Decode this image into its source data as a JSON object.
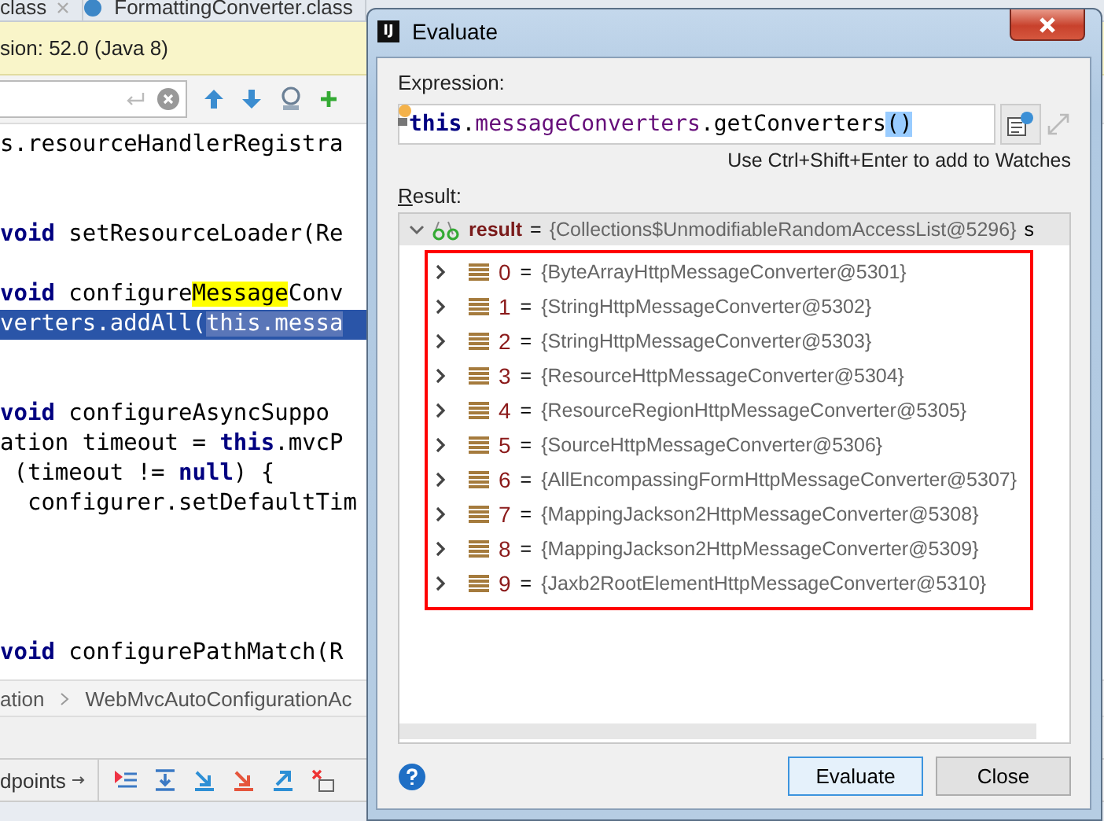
{
  "editor_tabs": [
    {
      "label": "class",
      "selected": false
    },
    {
      "label": "FormattingConverter.class",
      "selected": false
    }
  ],
  "banner": "sion: 52.0 (Java 8)",
  "code_lines": [
    {
      "selected": false,
      "tokens": [
        {
          "kind": "plain",
          "text": "s.resourceHandlerRegistra"
        }
      ]
    },
    {
      "selected": false
    },
    {
      "selected": false
    },
    {
      "selected": false,
      "tokens": [
        {
          "kind": "keyword",
          "text": "void"
        },
        {
          "kind": "plain",
          "text": " setResourceLoader(Re"
        }
      ]
    },
    {
      "selected": false
    },
    {
      "selected": false,
      "tokens": [
        {
          "kind": "keyword",
          "text": "void"
        },
        {
          "kind": "plain",
          "text": " configure"
        },
        {
          "kind": "match",
          "text": "Message"
        },
        {
          "kind": "plain",
          "text": "Conv"
        }
      ]
    },
    {
      "selected": true,
      "tokens": [
        {
          "kind": "plain",
          "text": "verters.addAll("
        },
        {
          "kind": "occurrence",
          "text": "this."
        },
        {
          "kind": "occurrence",
          "text": "messa"
        }
      ]
    },
    {
      "selected": false
    },
    {
      "selected": false
    },
    {
      "selected": false,
      "tokens": [
        {
          "kind": "keyword",
          "text": "void"
        },
        {
          "kind": "plain",
          "text": " configureAsyncSuppo"
        }
      ]
    },
    {
      "selected": false,
      "tokens": [
        {
          "kind": "plain",
          "text": "ation timeout = "
        },
        {
          "kind": "keyword",
          "text": "this"
        },
        {
          "kind": "plain",
          "text": ".mvcP"
        }
      ]
    },
    {
      "selected": false,
      "tokens": [
        {
          "kind": "plain",
          "text": " (timeout != "
        },
        {
          "kind": "keyword",
          "text": "null"
        },
        {
          "kind": "plain",
          "text": ") {"
        }
      ]
    },
    {
      "selected": false,
      "tokens": [
        {
          "kind": "plain",
          "text": "  configurer.setDefaultTim"
        }
      ]
    },
    {
      "selected": false
    },
    {
      "selected": false
    },
    {
      "selected": false
    },
    {
      "selected": false
    },
    {
      "selected": false,
      "tokens": [
        {
          "kind": "keyword",
          "text": "void"
        },
        {
          "kind": "plain",
          "text": " configurePathMatch(R"
        }
      ]
    }
  ],
  "breadcrumb": [
    "ation",
    "WebMvcAutoConfigurationAc"
  ],
  "debug_toolbar": {
    "label": "dpoints"
  },
  "dialog": {
    "logo": "IJ",
    "title": "Evaluate",
    "expression_label": "Expression:",
    "expression": [
      {
        "kind": "keyword",
        "text": "this"
      },
      {
        "kind": "plain",
        "text": "."
      },
      {
        "kind": "field",
        "text": "messageConverters"
      },
      {
        "kind": "plain",
        "text": ".getConverters"
      },
      {
        "kind": "brace",
        "text": "()"
      }
    ],
    "hint": "Use Ctrl+Shift+Enter to add to Watches",
    "result_label": "Result:",
    "result": {
      "name": "result",
      "op": "=",
      "value": "{Collections$UnmodifiableRandomAccessList@5296}",
      "extra": "s",
      "expanded": true,
      "children": [
        {
          "name": "0",
          "op": "=",
          "value": "{ByteArrayHttpMessageConverter@5301}",
          "expanded": false
        },
        {
          "name": "1",
          "op": "=",
          "value": "{StringHttpMessageConverter@5302}",
          "expanded": false
        },
        {
          "name": "2",
          "op": "=",
          "value": "{StringHttpMessageConverter@5303}",
          "expanded": false
        },
        {
          "name": "3",
          "op": "=",
          "value": "{ResourceHttpMessageConverter@5304}",
          "expanded": false
        },
        {
          "name": "4",
          "op": "=",
          "value": "{ResourceRegionHttpMessageConverter@5305}",
          "expanded": false
        },
        {
          "name": "5",
          "op": "=",
          "value": "{SourceHttpMessageConverter@5306}",
          "expanded": false
        },
        {
          "name": "6",
          "op": "=",
          "value": "{AllEncompassingFormHttpMessageConverter@5307}",
          "expanded": false
        },
        {
          "name": "7",
          "op": "=",
          "value": "{MappingJackson2HttpMessageConverter@5308}",
          "expanded": false
        },
        {
          "name": "8",
          "op": "=",
          "value": "{MappingJackson2HttpMessageConverter@5309}",
          "expanded": false
        },
        {
          "name": "9",
          "op": "=",
          "value": "{Jaxb2RootElementHttpMessageConverter@5310}",
          "expanded": false
        }
      ]
    },
    "buttons": [
      {
        "label": "Evaluate",
        "default": true
      },
      {
        "label": "Close",
        "default": false
      }
    ]
  }
}
